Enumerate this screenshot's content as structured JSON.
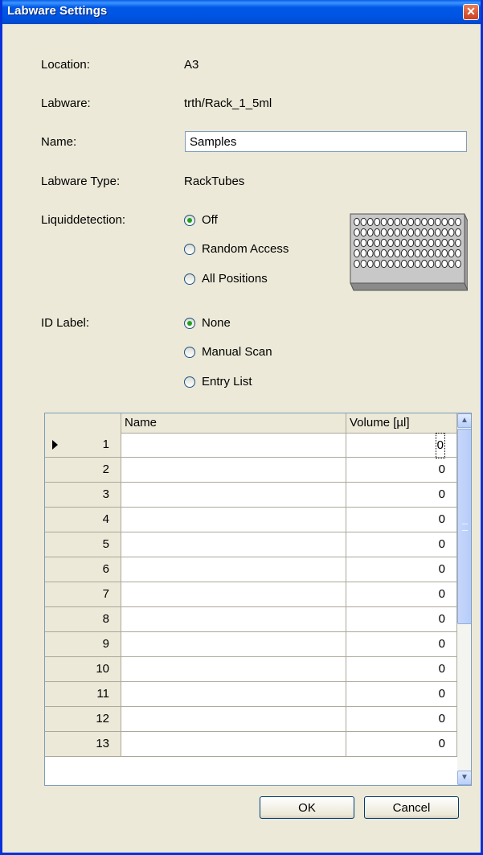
{
  "window": {
    "title": "Labware Settings"
  },
  "form": {
    "location_label": "Location:",
    "location_value": "A3",
    "labware_label": "Labware:",
    "labware_value": "trth/Rack_1_5ml",
    "name_label": "Name:",
    "name_value": "Samples",
    "type_label": "Labware Type:",
    "type_value": "RackTubes",
    "liquid_label": "Liquiddetection:",
    "liquid_options": [
      "Off",
      "Random Access",
      "All Positions"
    ],
    "liquid_selected": "Off",
    "id_label": "ID Label:",
    "id_options": [
      "None",
      "Manual Scan",
      "Entry List"
    ],
    "id_selected": "None"
  },
  "grid": {
    "columns": [
      "Name",
      "Volume [µl]"
    ],
    "rows": [
      {
        "index": "1",
        "name": "",
        "volume": "0"
      },
      {
        "index": "2",
        "name": "",
        "volume": "0"
      },
      {
        "index": "3",
        "name": "",
        "volume": "0"
      },
      {
        "index": "4",
        "name": "",
        "volume": "0"
      },
      {
        "index": "5",
        "name": "",
        "volume": "0"
      },
      {
        "index": "6",
        "name": "",
        "volume": "0"
      },
      {
        "index": "7",
        "name": "",
        "volume": "0"
      },
      {
        "index": "8",
        "name": "",
        "volume": "0"
      },
      {
        "index": "9",
        "name": "",
        "volume": "0"
      },
      {
        "index": "10",
        "name": "",
        "volume": "0"
      },
      {
        "index": "11",
        "name": "",
        "volume": "0"
      },
      {
        "index": "12",
        "name": "",
        "volume": "0"
      },
      {
        "index": "13",
        "name": "",
        "volume": "0"
      }
    ]
  },
  "buttons": {
    "ok": "OK",
    "cancel": "Cancel"
  },
  "colors": {
    "titlebar": "#0054e3",
    "dialog_bg": "#ece9d8",
    "radio_dot": "#21a121"
  }
}
